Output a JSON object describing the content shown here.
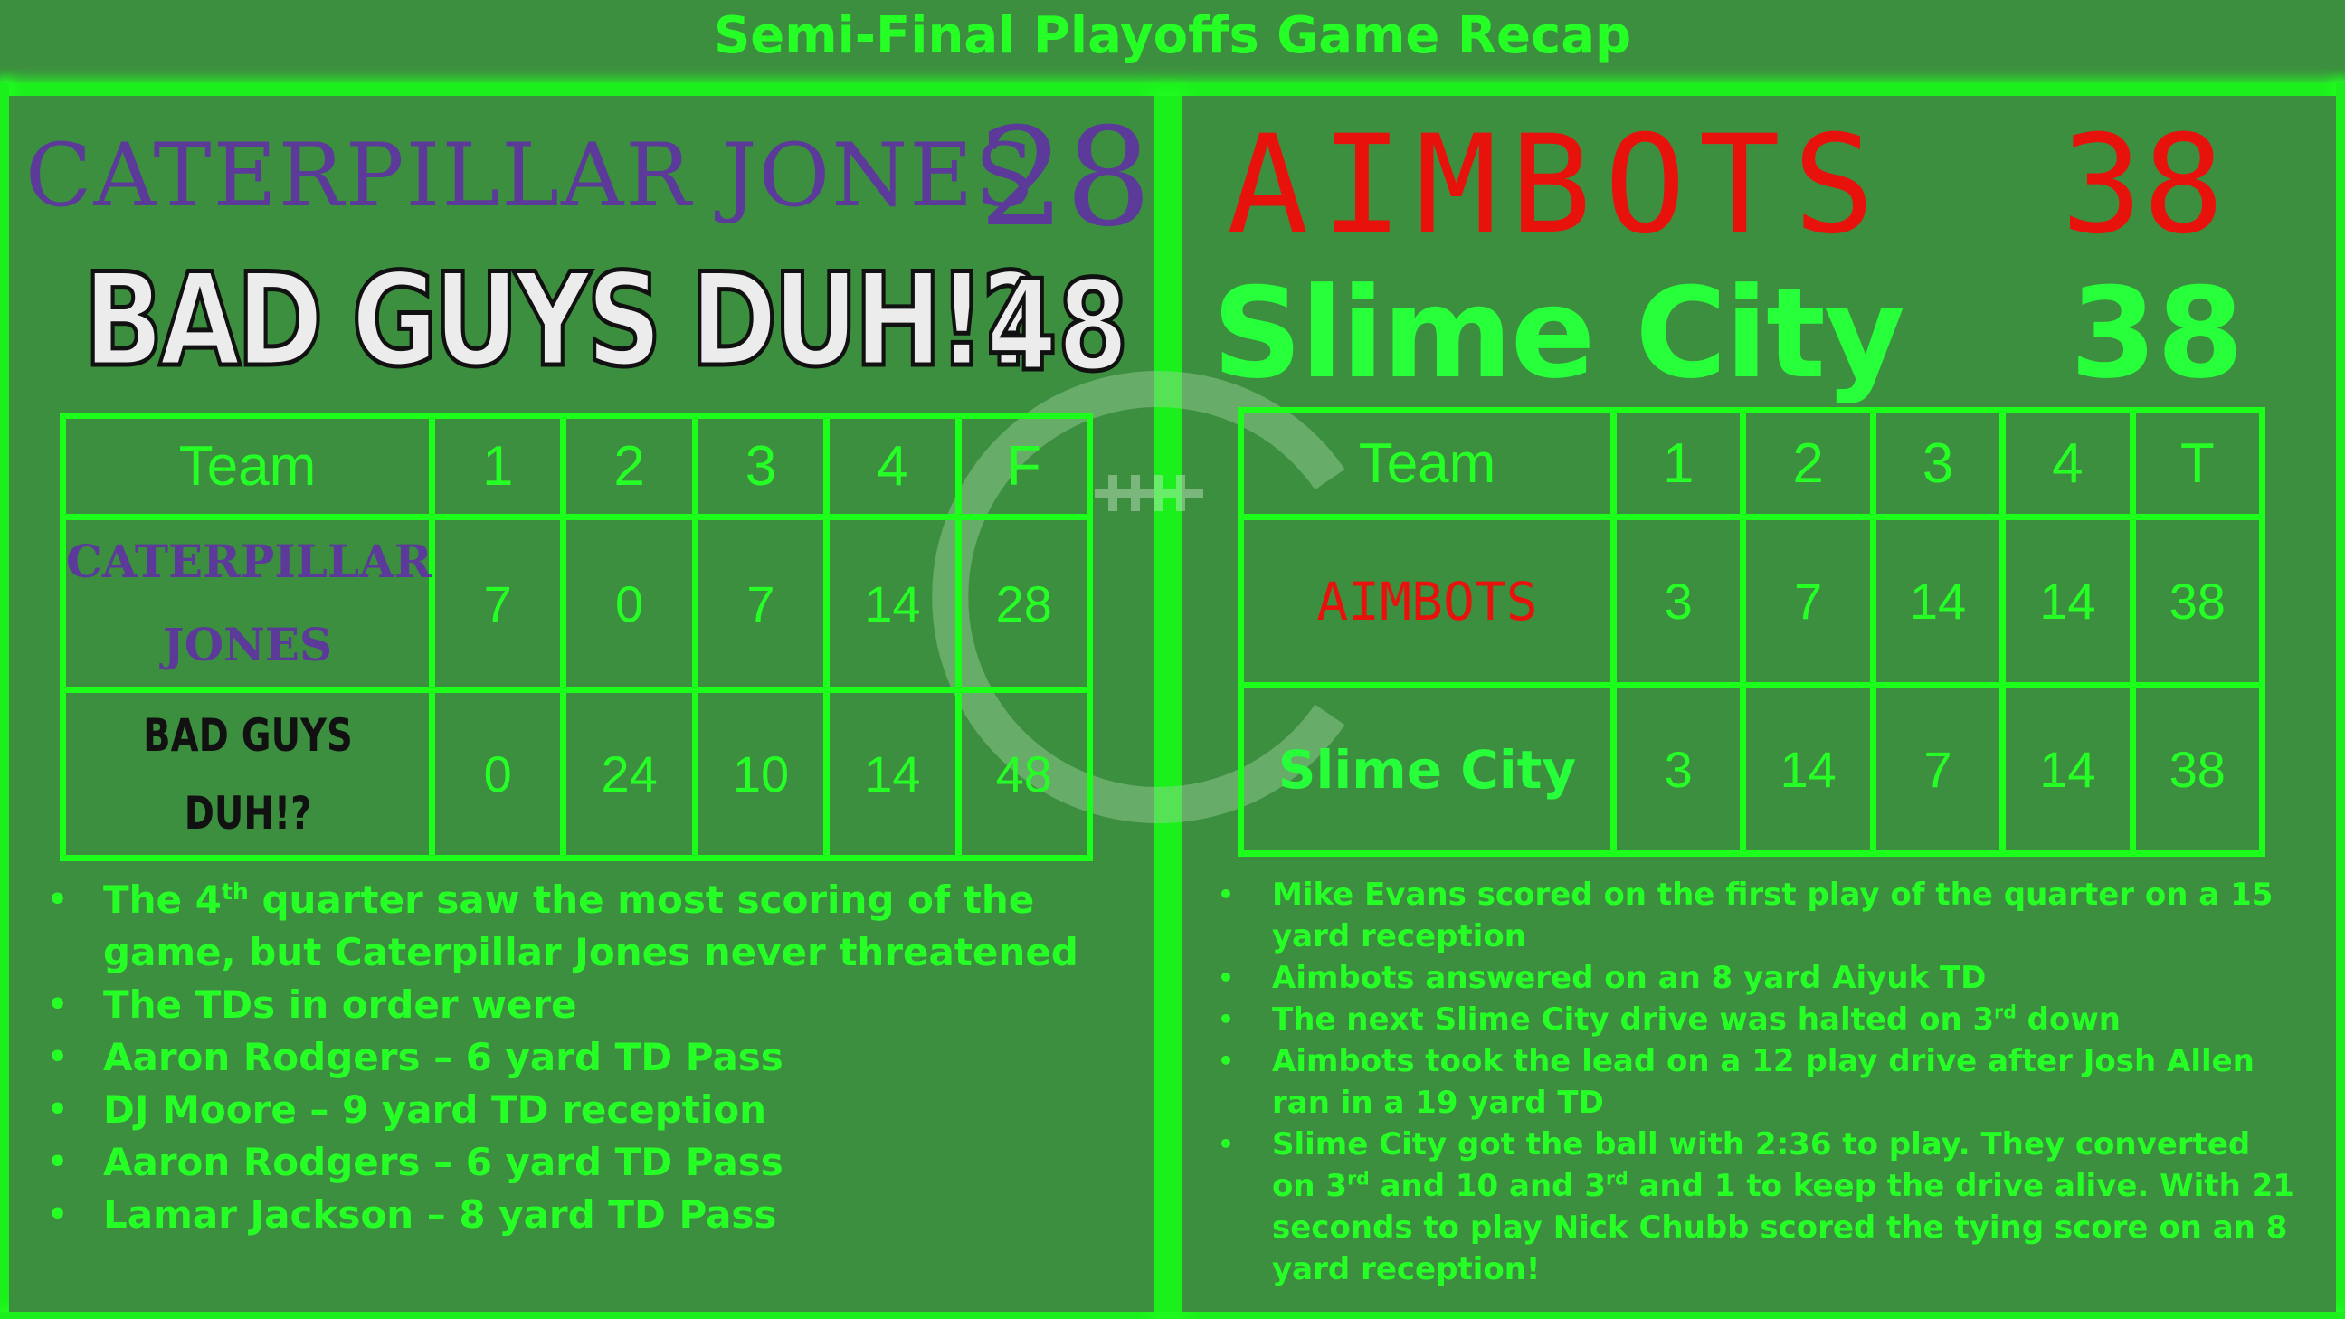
{
  "title": "Semi-Final Playoffs Game Recap",
  "colors": {
    "background": "#3d8f40",
    "neon_green": "#26ff26",
    "caterpillar_purple": "#5b3a9a",
    "aimbots_red": "#e8120c"
  },
  "left_game": {
    "team1": {
      "name": "CATERPILLAR JONES",
      "score": "28"
    },
    "team2": {
      "name": "BAD GUYS DUH!?",
      "score": "48"
    },
    "table": {
      "headers": [
        "Team",
        "1",
        "2",
        "3",
        "4",
        "F"
      ],
      "rows": [
        {
          "team": "CATERPILLAR JONES",
          "q": [
            "7",
            "0",
            "7",
            "14",
            "28"
          ]
        },
        {
          "team": "BAD GUYS DUH!?",
          "q": [
            "0",
            "24",
            "10",
            "14",
            "48"
          ]
        }
      ]
    },
    "notes": [
      {
        "text": "The 4",
        "sup": "th",
        "rest": " quarter saw the most scoring of the game, but Caterpillar Jones never threatened"
      },
      {
        "text": "The TDs in order were"
      },
      {
        "text": "Aaron Rodgers – 6 yard TD Pass"
      },
      {
        "text": "DJ Moore – 9 yard TD reception"
      },
      {
        "text": "Aaron Rodgers – 6 yard TD Pass"
      },
      {
        "text": "Lamar Jackson – 8 yard TD Pass"
      }
    ]
  },
  "right_game": {
    "team1": {
      "name": "AIMBOTS",
      "score": "38"
    },
    "team2": {
      "name": "Slime City",
      "score": "38"
    },
    "table": {
      "headers": [
        "Team",
        "1",
        "2",
        "3",
        "4",
        "T"
      ],
      "rows": [
        {
          "team": "AIMBOTS",
          "q": [
            "3",
            "7",
            "14",
            "14",
            "38"
          ]
        },
        {
          "team": "Slime City",
          "q": [
            "3",
            "14",
            "7",
            "14",
            "38"
          ]
        }
      ]
    },
    "notes": [
      {
        "text": "Mike Evans scored on the first play of the quarter on a 15 yard reception"
      },
      {
        "text": "Aimbots answered on an 8 yard Aiyuk TD"
      },
      {
        "text": "The next Slime City drive was halted on 3",
        "sup": "rd",
        "rest": " down"
      },
      {
        "text": "Aimbots took the lead on a 12 play drive after Josh Allen ran in a 19 yard TD"
      },
      {
        "text": "Slime City got the ball with 2:36 to play. They converted on 3",
        "sup": "rd",
        "rest": " and 10 and 3",
        "sup2": "rd",
        "rest2": " and 1 to keep the drive alive. With 21 seconds to play Nick Chubb scored the tying score on an 8 yard reception!"
      }
    ]
  }
}
